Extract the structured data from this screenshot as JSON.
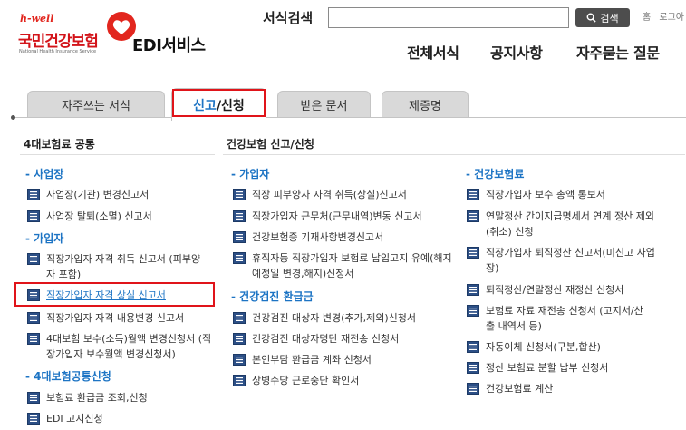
{
  "brand": {
    "hwell": "h-well",
    "name_kr": "국민건강보험",
    "name_en": "National Health Insurance Service",
    "service": "EDI서비스",
    "colors": {
      "red": "#d3141a",
      "blue": "#1d74c4"
    }
  },
  "search": {
    "label": "서식검색",
    "value": "",
    "button": "검색"
  },
  "util": {
    "home": "홈",
    "login": "로그아"
  },
  "nav": [
    "전체서식",
    "공지사항",
    "자주묻는 질문"
  ],
  "tabs": {
    "t1": "자주쓰는 서식",
    "t2_a": "신고",
    "t2_b": "/신청",
    "t3": "받은 문서",
    "t4": "제증명"
  },
  "left": {
    "title": "4대보험료 공통",
    "g1": "- 사업장",
    "g1_items": [
      "사업장(기관) 변경신고서",
      "사업장 탈퇴(소멸) 신고서"
    ],
    "g2": "- 가입자",
    "g2_items": [
      "직장가입자 자격 취득 신고서 (피부양자 포함)",
      "직장가입자 자격 상실 신고서",
      "직장가입자 자격 내용변경 신고서",
      "4대보험 보수(소득)월액 변경신청서 (직장가입자 보수월액 변경신청서)"
    ],
    "g3": "- 4대보험공통신청",
    "g3_items": [
      "보험료 환급금 조회,신청",
      "EDI 고지신청"
    ]
  },
  "right": {
    "title": "건강보험 신고/신청",
    "g1": "- 가입자",
    "g1_items": [
      "직장 피부양자 자격 취득(상실)신고서",
      "직장가입자 근무처(근무내역)변동 신고서",
      "건강보험증 기재사항변경신고서",
      "휴직자등 직장가입자 보험료 납입고지 유예(해지 예정일 변경,해지)신청서"
    ],
    "g2": "- 건강검진 환급금",
    "g2_items": [
      "건강검진 대상자 변경(추가,제외)신청서",
      "건강검진 대상자명단 재전송 신청서",
      "본인부담 환급금 계좌 신청서",
      "상병수당 근로중단 확인서"
    ],
    "g3": "- 건강보험료",
    "g3_items": [
      "직장가입자 보수 총액 통보서",
      "연말정산 간이지급명세서 연계 정산 제외(취소) 신청",
      "직장가입자 퇴직정산 신고서(미신고 사업장)",
      "퇴직정산/연말정산 재정산 신청서",
      "보험료 자료 재전송 신청서 (고지서/산출 내역서 등)",
      "자동이체 신청서(구분,합산)",
      "정산 보험료 분할 납부 신청서",
      "건강보험료 계산"
    ]
  }
}
